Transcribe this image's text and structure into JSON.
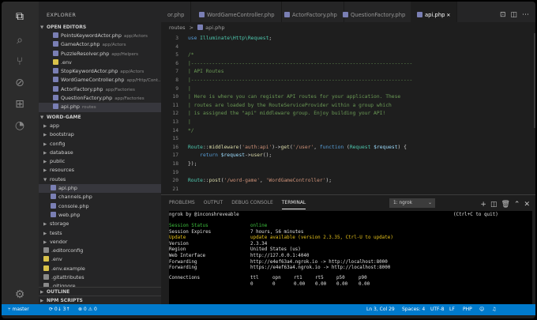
{
  "explorer": {
    "title": "EXPLORER",
    "open_editors_label": "OPEN EDITORS",
    "open_editors": [
      {
        "name": "PointsKeywordActor.php",
        "desc": "app/Actors",
        "type": "php"
      },
      {
        "name": "GameActor.php",
        "desc": "app/Actors",
        "type": "php"
      },
      {
        "name": "PuzzleResolver.php",
        "desc": "app/Helpers",
        "type": "php"
      },
      {
        "name": ".env",
        "desc": "",
        "type": "env"
      },
      {
        "name": "StopKeywordActor.php",
        "desc": "app/Actors",
        "type": "php"
      },
      {
        "name": "WordGameController.php",
        "desc": "app/Http/Cont...",
        "type": "php"
      },
      {
        "name": "ActorFactory.php",
        "desc": "app/Factories",
        "type": "php"
      },
      {
        "name": "QuestionFactory.php",
        "desc": "app/Factories",
        "type": "php"
      },
      {
        "name": "api.php",
        "desc": "routes",
        "type": "php"
      }
    ],
    "project_label": "WORD-GAME",
    "tree": [
      {
        "name": "app",
        "folder": true,
        "open": false,
        "depth": 0
      },
      {
        "name": "bootstrap",
        "folder": true,
        "open": false,
        "depth": 0
      },
      {
        "name": "config",
        "folder": true,
        "open": false,
        "depth": 0
      },
      {
        "name": "database",
        "folder": true,
        "open": false,
        "depth": 0
      },
      {
        "name": "public",
        "folder": true,
        "open": false,
        "depth": 0
      },
      {
        "name": "resources",
        "folder": true,
        "open": false,
        "depth": 0
      },
      {
        "name": "routes",
        "folder": true,
        "open": true,
        "depth": 0
      },
      {
        "name": "api.php",
        "folder": false,
        "type": "php",
        "depth": 1,
        "selected": true
      },
      {
        "name": "channels.php",
        "folder": false,
        "type": "php",
        "depth": 1
      },
      {
        "name": "console.php",
        "folder": false,
        "type": "php",
        "depth": 1
      },
      {
        "name": "web.php",
        "folder": false,
        "type": "php",
        "depth": 1
      },
      {
        "name": "storage",
        "folder": true,
        "open": false,
        "depth": 0
      },
      {
        "name": "tests",
        "folder": true,
        "open": false,
        "depth": 0
      },
      {
        "name": "vendor",
        "folder": true,
        "open": false,
        "depth": 0
      },
      {
        "name": ".editorconfig",
        "folder": false,
        "type": "gen",
        "depth": 0
      },
      {
        "name": ".env",
        "folder": false,
        "type": "env",
        "depth": 0
      },
      {
        "name": ".env.example",
        "folder": false,
        "type": "env",
        "depth": 0
      },
      {
        "name": ".gitattributes",
        "folder": false,
        "type": "gen",
        "depth": 0
      },
      {
        "name": ".gitignore",
        "folder": false,
        "type": "gen",
        "depth": 0
      }
    ],
    "outline_label": "OUTLINE",
    "npm_label": "NPM SCRIPTS"
  },
  "tabs": [
    {
      "label": "or.php",
      "active": false
    },
    {
      "label": "WordGameController.php",
      "active": false
    },
    {
      "label": "ActorFactory.php",
      "active": false
    },
    {
      "label": "QuestionFactory.php",
      "active": false
    },
    {
      "label": "api.php",
      "active": true
    }
  ],
  "breadcrumb": {
    "folder": "routes",
    "sep": ">",
    "file": "api.php"
  },
  "code_lines": [
    {
      "n": "3",
      "html": "<span class='kw'>use</span> <span class='cls'>Illuminate\\Http\\Request</span>;"
    },
    {
      "n": "4",
      "html": ""
    },
    {
      "n": "5",
      "html": "<span class='cm'>/*</span>"
    },
    {
      "n": "6",
      "html": "<span class='cm'>|--------------------------------------------------------------------------</span>"
    },
    {
      "n": "7",
      "html": "<span class='cm'>| API Routes</span>"
    },
    {
      "n": "8",
      "html": "<span class='cm'>|--------------------------------------------------------------------------</span>"
    },
    {
      "n": "9",
      "html": "<span class='cm'>|</span>"
    },
    {
      "n": "10",
      "html": "<span class='cm'>| Here is where you can register API routes for your application. These</span>"
    },
    {
      "n": "11",
      "html": "<span class='cm'>| routes are loaded by the RouteServiceProvider within a group which</span>"
    },
    {
      "n": "12",
      "html": "<span class='cm'>| is assigned the \"api\" middleware group. Enjoy building your API!</span>"
    },
    {
      "n": "13",
      "html": "<span class='cm'>|</span>"
    },
    {
      "n": "14",
      "html": "<span class='cm'>*/</span>"
    },
    {
      "n": "15",
      "html": ""
    },
    {
      "n": "16",
      "html": "<span class='cls'>Route</span>::<span class='fn'>middleware</span>(<span class='str'>'auth:api'</span>)-&gt;<span class='fn'>get</span>(<span class='str'>'/user'</span>, <span class='kw'>function</span> (<span class='cls'>Request</span> <span class='var'>$request</span>) {"
    },
    {
      "n": "17",
      "html": "    <span class='kw'>return</span> <span class='var'>$request</span>-&gt;<span class='fn'>user</span>();"
    },
    {
      "n": "18",
      "html": "});"
    },
    {
      "n": "19",
      "html": ""
    },
    {
      "n": "20",
      "html": "<span class='cls'>Route</span>::<span class='fn'>post</span>(<span class='str'>'/word-game'</span>, <span class='str'>'WordGameController'</span>);"
    },
    {
      "n": "21",
      "html": ""
    }
  ],
  "panel": {
    "tabs": [
      "PROBLEMS",
      "OUTPUT",
      "DEBUG CONSOLE",
      "TERMINAL"
    ],
    "active_tab": "TERMINAL",
    "terminal_select": "1: ngrok",
    "icons": [
      "+",
      "◫",
      "✕",
      "⌃",
      "✕"
    ]
  },
  "terminal": {
    "header_left": "ngrok by @inconshreveable",
    "header_right": "(Ctrl+C to quit)",
    "rows": [
      {
        "k": "Session Status",
        "v": "online",
        "color": "green"
      },
      {
        "k": "Session Expires",
        "v": "7 hours, 56 minutes",
        "color": ""
      },
      {
        "k": "Update",
        "v": "update available (version 2.3.35, Ctrl-U to update)",
        "color": "yellow"
      },
      {
        "k": "Version",
        "v": "2.3.34",
        "color": ""
      },
      {
        "k": "Region",
        "v": "United States (us)",
        "color": ""
      },
      {
        "k": "Web Interface",
        "v": "http://127.0.0.1:4040",
        "color": ""
      },
      {
        "k": "Forwarding",
        "v": "http://e4ef63a4.ngrok.io -> http://localhost:8000",
        "color": ""
      },
      {
        "k": "Forwarding",
        "v": "https://e4ef63a4.ngrok.io -> http://localhost:8000",
        "color": ""
      }
    ],
    "conn_label": "Connections",
    "conn_headers": [
      "ttl",
      "opn",
      "rt1",
      "rt5",
      "p50",
      "p90"
    ],
    "conn_values": [
      "0",
      "0",
      "0.00",
      "0.00",
      "0.00",
      "0.00"
    ]
  },
  "status": {
    "branch": "master",
    "sync": "⟳ 0↓ 3↑",
    "errors": "⊗ 0 ⚠ 0",
    "position": "Ln 3, Col 29",
    "spaces": "Spaces: 4",
    "encoding": "UTF-8",
    "eol": "LF",
    "language": "PHP"
  },
  "colors": {
    "accent": "#007acc",
    "sidebar": "#252526",
    "editor": "#1e1e1e"
  }
}
